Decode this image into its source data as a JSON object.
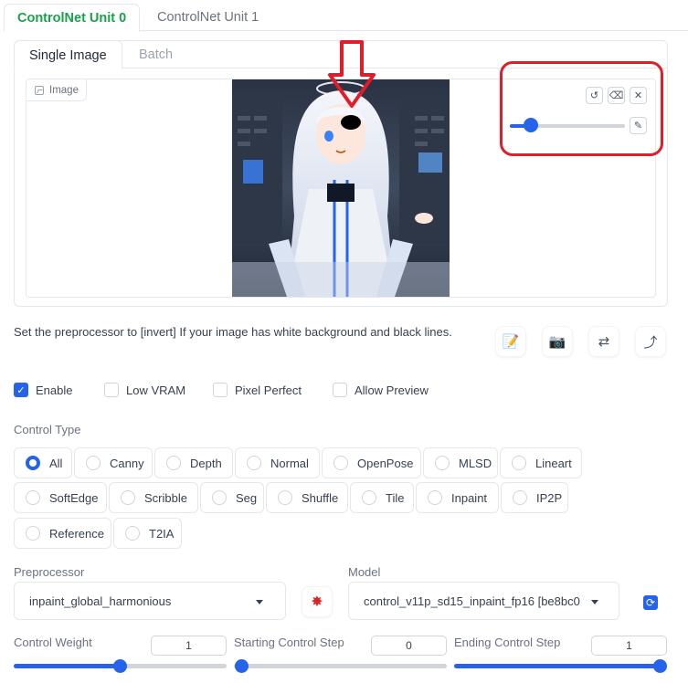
{
  "unit_tabs": [
    "ControlNet Unit 0",
    "ControlNet Unit 1"
  ],
  "image_tabs": [
    "Single Image",
    "Batch"
  ],
  "image_panel": {
    "label": "Image",
    "brush_size_fraction": 0.12
  },
  "hint_text": "Set the preprocessor to [invert] If your image has white background and black lines.",
  "checkboxes": [
    {
      "label": "Enable",
      "checked": true
    },
    {
      "label": "Low VRAM",
      "checked": false
    },
    {
      "label": "Pixel Perfect",
      "checked": false
    },
    {
      "label": "Allow Preview",
      "checked": false
    }
  ],
  "control_type": {
    "label": "Control Type",
    "selected": "All",
    "options": [
      "All",
      "Canny",
      "Depth",
      "Normal",
      "OpenPose",
      "MLSD",
      "Lineart",
      "SoftEdge",
      "Scribble",
      "Seg",
      "Shuffle",
      "Tile",
      "Inpaint",
      "IP2P",
      "Reference",
      "T2IA"
    ]
  },
  "preprocessor": {
    "label": "Preprocessor",
    "value": "inpaint_global_harmonious"
  },
  "model": {
    "label": "Model",
    "value": "control_v11p_sd15_inpaint_fp16 [be8bc0"
  },
  "sliders": [
    {
      "label": "Control Weight",
      "value": "1",
      "fraction": 0.5
    },
    {
      "label": "Starting Control Step",
      "value": "0",
      "fraction": 0.0
    },
    {
      "label": "Ending Control Step",
      "value": "1",
      "fraction": 1.0
    }
  ],
  "colors": {
    "accent": "#2563eb",
    "active_tab": "#16a34a",
    "annotation": "#e11d2a"
  }
}
